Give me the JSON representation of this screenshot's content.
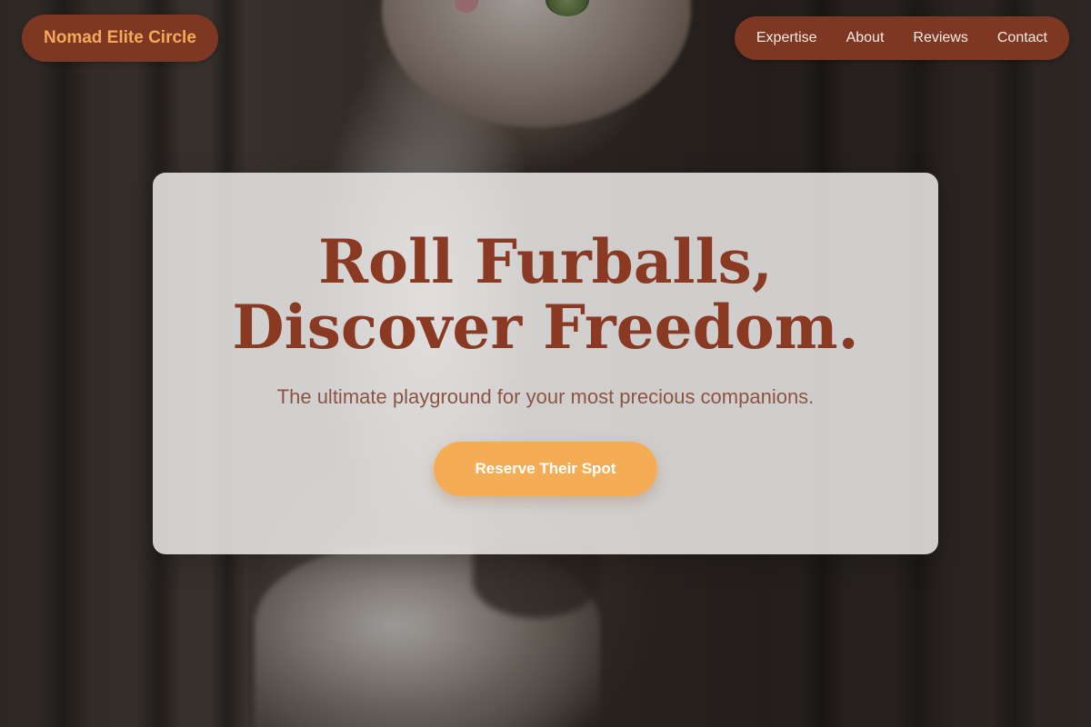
{
  "brand": {
    "name": "Nomad Elite Circle"
  },
  "nav": {
    "items": [
      {
        "label": "Expertise"
      },
      {
        "label": "About"
      },
      {
        "label": "Reviews"
      },
      {
        "label": "Contact"
      }
    ]
  },
  "hero": {
    "title_line1": "Roll Furballs,",
    "title_line2": "Discover Freedom.",
    "subtitle": "The ultimate playground for your most precious companions.",
    "cta_label": "Reserve Their Spot",
    "background_image": "cat-photo"
  },
  "colors": {
    "brand_bg": "#7d3722",
    "brand_text": "#f5a85a",
    "title": "#8a3a22",
    "cta": "#f5ad55"
  }
}
